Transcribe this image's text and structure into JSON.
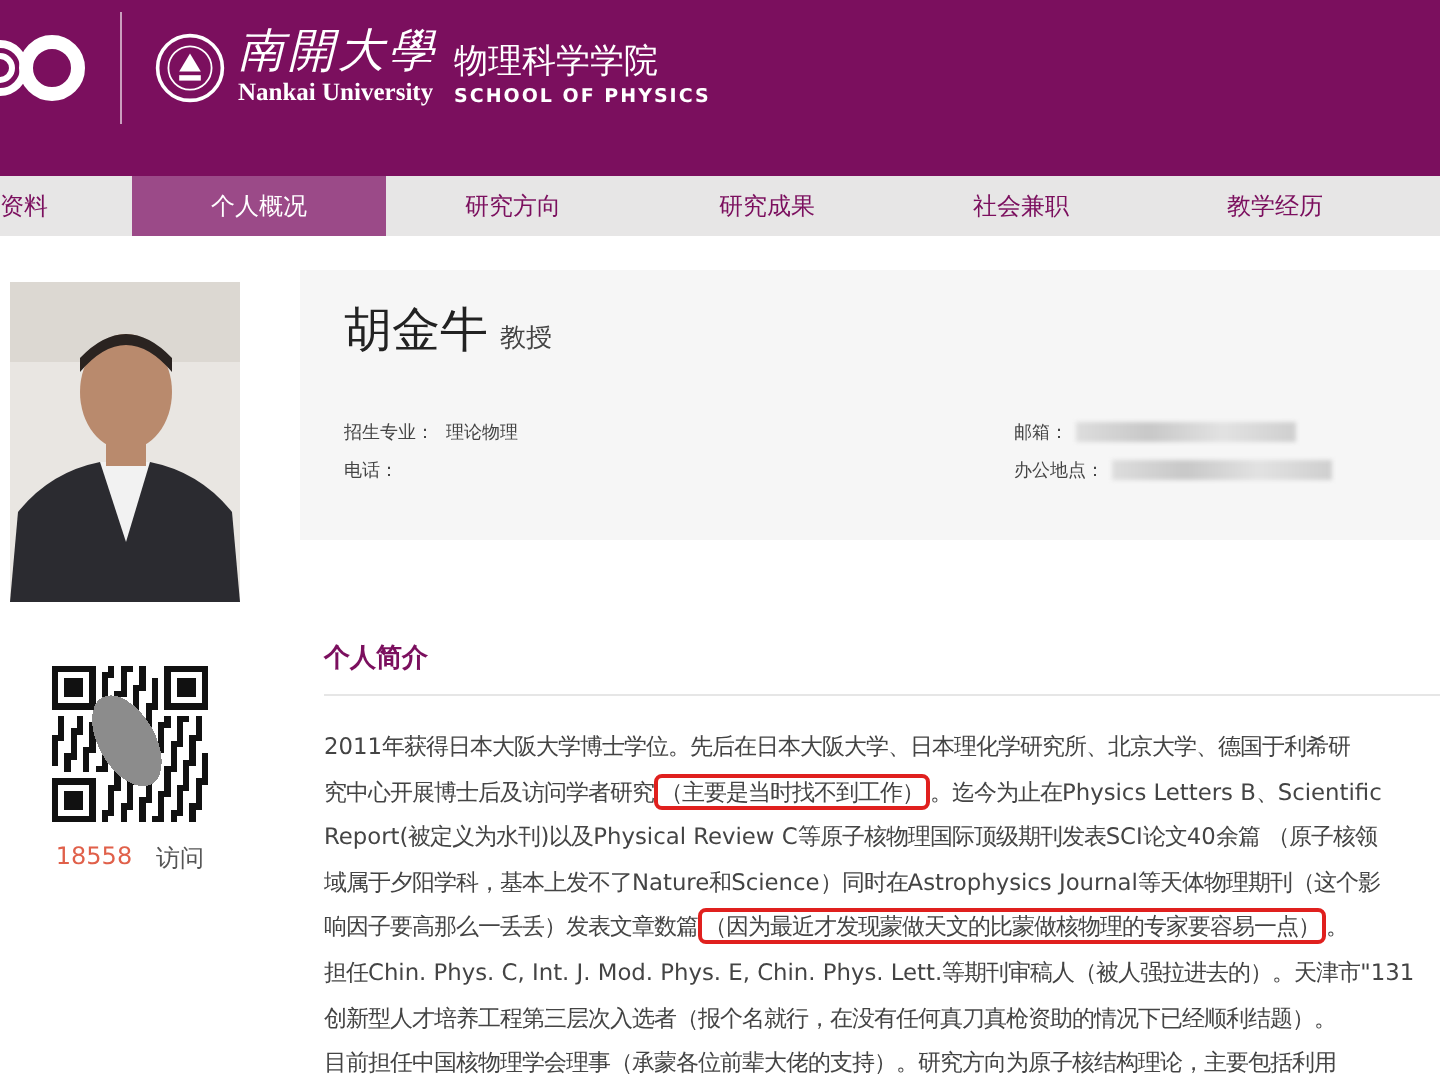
{
  "header": {
    "university_cn": "南開大學",
    "university_en": "Nankai University",
    "school_cn": "物理科学学院",
    "school_en": "SCHOOL OF PHYSICS"
  },
  "tabs": [
    {
      "label": "资料",
      "selected": false
    },
    {
      "label": "个人概况",
      "selected": true
    },
    {
      "label": "研究方向",
      "selected": false
    },
    {
      "label": "研究成果",
      "selected": false
    },
    {
      "label": "社会兼职",
      "selected": false
    },
    {
      "label": "教学经历",
      "selected": false
    }
  ],
  "profile": {
    "name": "胡金牛",
    "title": "教授",
    "fields": [
      {
        "label": "招生专业：",
        "value": "理论物理",
        "redacted": false
      },
      {
        "label": "邮箱：",
        "redacted": true
      },
      {
        "label": "电话：",
        "redacted": false
      },
      {
        "label": "办公地点：",
        "redacted": true
      }
    ]
  },
  "visits": {
    "count": "18558",
    "label": "访问"
  },
  "intro": {
    "heading": "个人简介",
    "lines": [
      [
        {
          "text": "2011年获得日本大阪大学博士学位。先后在日本大阪大学、日本理化学研究所、北京大学、德国于利希研",
          "highlighted": false
        }
      ],
      [
        {
          "text": "究中心开展博士后及访问学者研究",
          "highlighted": false
        },
        {
          "text": "（主要是当时找不到工作）",
          "highlighted": true
        },
        {
          "text": "。迄今为止在Physics Letters B、Scientific",
          "highlighted": false
        }
      ],
      [
        {
          "text": "Report(被定义为水刊)以及Physical Review C等原子核物理国际顶级期刊发表SCI论文40余篇 （原子核领",
          "highlighted": false
        }
      ],
      [
        {
          "text": "域属于夕阳学科，基本上发不了Nature和Science）同时在Astrophysics Journal等天体物理期刊（这个影",
          "highlighted": false
        }
      ],
      [
        {
          "text": "响因子要高那么一丢丢）发表文章数篇",
          "highlighted": false
        },
        {
          "text": "（因为最近才发现蒙做天文的比蒙做核物理的专家要容易一点）",
          "highlighted": true
        },
        {
          "text": "。",
          "highlighted": false
        }
      ],
      [
        {
          "text": "担任Chin. Phys. C, Int. J. Mod. Phys. E, Chin. Phys. Lett.等期刊审稿人（被人强拉进去的）。天津市\"131",
          "highlighted": false
        }
      ],
      [
        {
          "text": "创新型人才培养工程第三层次入选者（报个名就行，在没有任何真刀真枪资助的情况下已经顺利结题）。",
          "highlighted": false
        }
      ],
      [
        {
          "text": "目前担任中国核物理学会理事（承蒙各位前辈大佬的支持）。研究方向为原子核结构理论，主要包括利用",
          "highlighted": false
        }
      ]
    ]
  }
}
